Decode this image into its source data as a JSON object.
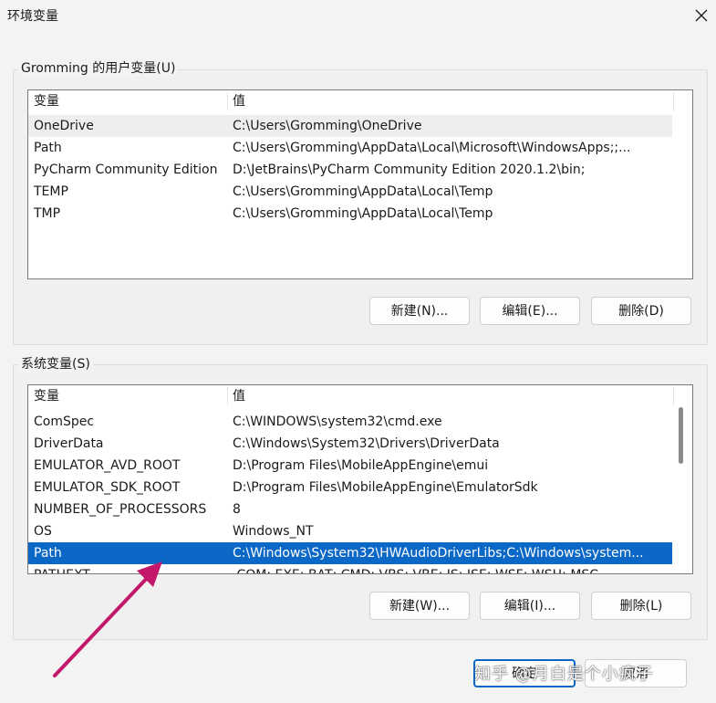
{
  "window": {
    "title": "环境变量"
  },
  "user_vars": {
    "group_label": "Gromming 的用户变量(U)",
    "col_name": "变量",
    "col_value": "值",
    "rows": [
      {
        "name": "OneDrive",
        "value": "C:\\Users\\Gromming\\OneDrive"
      },
      {
        "name": "Path",
        "value": "C:\\Users\\Gromming\\AppData\\Local\\Microsoft\\WindowsApps;;..."
      },
      {
        "name": "PyCharm Community Edition",
        "value": "D:\\JetBrains\\PyCharm Community Edition 2020.1.2\\bin;"
      },
      {
        "name": "TEMP",
        "value": "C:\\Users\\Gromming\\AppData\\Local\\Temp"
      },
      {
        "name": "TMP",
        "value": "C:\\Users\\Gromming\\AppData\\Local\\Temp"
      }
    ],
    "buttons": {
      "new": "新建(N)...",
      "edit": "编辑(E)...",
      "delete": "删除(D)"
    }
  },
  "system_vars": {
    "group_label": "系统变量(S)",
    "col_name": "变量",
    "col_value": "值",
    "rows": [
      {
        "name": "ComSpec",
        "value": "C:\\WINDOWS\\system32\\cmd.exe"
      },
      {
        "name": "DriverData",
        "value": "C:\\Windows\\System32\\Drivers\\DriverData"
      },
      {
        "name": "EMULATOR_AVD_ROOT",
        "value": "D:\\Program Files\\MobileAppEngine\\emui"
      },
      {
        "name": "EMULATOR_SDK_ROOT",
        "value": "D:\\Program Files\\MobileAppEngine\\EmulatorSdk"
      },
      {
        "name": "NUMBER_OF_PROCESSORS",
        "value": "8"
      },
      {
        "name": "OS",
        "value": "Windows_NT"
      },
      {
        "name": "Path",
        "value": "C:\\Windows\\System32\\HWAudioDriverLibs;C:\\Windows\\system..."
      },
      {
        "name": "PATHEXT",
        "value": ".COM;.EXE;.BAT;.CMD;.VBS;.VBE;.JS;.JSE;.WSF;.WSH;.MSC"
      }
    ],
    "buttons": {
      "new": "新建(W)...",
      "edit": "编辑(I)...",
      "delete": "删除(L)"
    }
  },
  "footer": {
    "ok": "确定",
    "cancel": "取消"
  },
  "watermark": "知乎 @月白是个小疯子",
  "colors": {
    "selection": "#0b68c7",
    "arrow": "#c2176a"
  }
}
